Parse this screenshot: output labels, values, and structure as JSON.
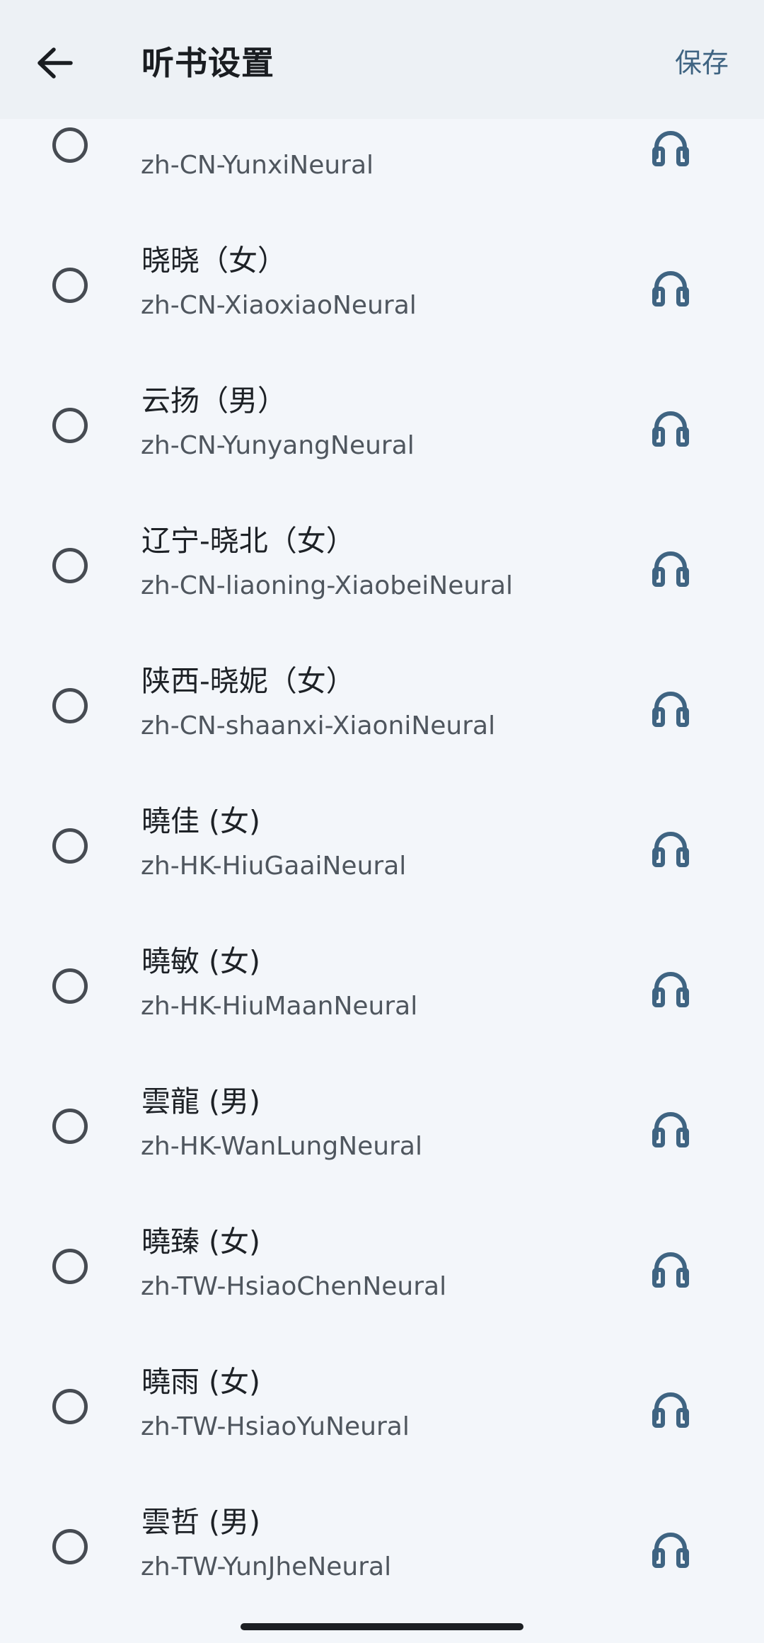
{
  "header": {
    "title": "听书设置",
    "save_label": "保存",
    "back_icon": "arrow-left-icon"
  },
  "voices": [
    {
      "name": "",
      "code": "zh-CN-YunxiNeural",
      "selected": false
    },
    {
      "name": "晓晓（女）",
      "code": "zh-CN-XiaoxiaoNeural",
      "selected": false
    },
    {
      "name": "云扬（男）",
      "code": "zh-CN-YunyangNeural",
      "selected": false
    },
    {
      "name": "辽宁-晓北（女）",
      "code": "zh-CN-liaoning-XiaobeiNeural",
      "selected": false
    },
    {
      "name": "陕西-晓妮（女）",
      "code": "zh-CN-shaanxi-XiaoniNeural",
      "selected": false
    },
    {
      "name": "曉佳 (女)",
      "code": "zh-HK-HiuGaaiNeural",
      "selected": false
    },
    {
      "name": "曉敏 (女)",
      "code": "zh-HK-HiuMaanNeural",
      "selected": false
    },
    {
      "name": "雲龍 (男)",
      "code": "zh-HK-WanLungNeural",
      "selected": false
    },
    {
      "name": "曉臻 (女)",
      "code": "zh-TW-HsiaoChenNeural",
      "selected": false
    },
    {
      "name": "曉雨 (女)",
      "code": "zh-TW-HsiaoYuNeural",
      "selected": false
    },
    {
      "name": "雲哲 (男)",
      "code": "zh-TW-YunJheNeural",
      "selected": false
    }
  ],
  "colors": {
    "background": "#f3f6fa",
    "header_background": "#edf1f5",
    "accent": "#3f6482",
    "radio_border": "#464b52"
  },
  "icons": {
    "preview": "headphones-icon",
    "radio": "radio-unselected-icon"
  }
}
